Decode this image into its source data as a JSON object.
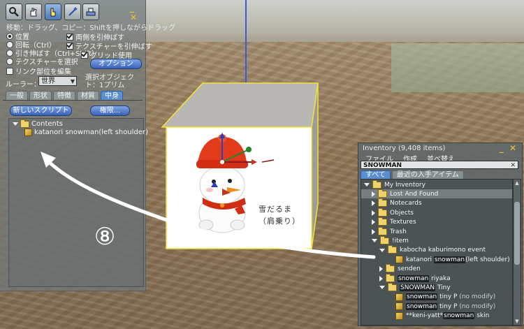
{
  "tool_panel": {
    "tools": [
      {
        "name": "zoom-tool-icon"
      },
      {
        "name": "grab-tool-icon"
      },
      {
        "name": "edit-tool-icon",
        "active": true
      },
      {
        "name": "create-tool-icon"
      },
      {
        "name": "land-tool-icon"
      }
    ],
    "window_controls": "_ ✕",
    "hint": "移動：ドラッグ、コピー：Shiftを押しながらドラッグ",
    "mode_options": [
      {
        "label": "位置",
        "selected": true
      },
      {
        "label": "回転（Ctrl）",
        "selected": false
      },
      {
        "label": "引き伸ばす（Ctrl+Shift）",
        "selected": false
      },
      {
        "label": "テクスチャーを選択",
        "selected": false
      }
    ],
    "checkbox_options": [
      {
        "label": "両側を引伸ばす",
        "checked": true
      },
      {
        "label": "テクスチャーを引伸ばす",
        "checked": true
      },
      {
        "label": "グリッド使用",
        "checked": true
      }
    ],
    "link_option": {
      "label": "リンク部位を編集",
      "checked": false
    },
    "options_button": "オプション",
    "ruler_label": "ルーラー：",
    "ruler_value": "世界",
    "ruler_note": "選択オブジェクト：1プリム",
    "tabs": [
      "一般",
      "形状",
      "特徴",
      "材質",
      "中身"
    ],
    "active_tab": "中身",
    "new_script_button": "新しいスクリプト",
    "permissions_button": "権限...",
    "contents": {
      "folder": "Contents",
      "items": [
        "katanori snowman(left shoulder)"
      ]
    }
  },
  "scene": {
    "label_line1": "雪だるま",
    "label_line2": "（肩乗り）"
  },
  "inventory": {
    "title": "Inventory (9,408 items)",
    "window_controls": "_ ✕",
    "menu": [
      "ファイル",
      "作成",
      "並べ替え"
    ],
    "search_value": "SNOWMAN",
    "search_clear": "✕",
    "tabs": [
      "すべて",
      "最近の入手アイテム"
    ],
    "rows": [
      {
        "depth": 0,
        "expander": "down",
        "icon": "folder",
        "label": "My Inventory"
      },
      {
        "depth": 1,
        "expander": "right",
        "icon": "folder-special",
        "label": "Lost And Found",
        "selected": true
      },
      {
        "depth": 1,
        "expander": "right",
        "icon": "folder-special",
        "label": "Notecards"
      },
      {
        "depth": 1,
        "expander": "right",
        "icon": "folder-special",
        "label": "Objects"
      },
      {
        "depth": 1,
        "expander": "right",
        "icon": "folder-special",
        "label": "Textures"
      },
      {
        "depth": 1,
        "expander": "right",
        "icon": "folder-special",
        "label": "Trash"
      },
      {
        "depth": 1,
        "expander": "down",
        "icon": "folder",
        "label": "!item"
      },
      {
        "depth": 2,
        "expander": "down",
        "icon": "folder",
        "label": "kabocha kaburimono event"
      },
      {
        "depth": 3,
        "expander": "none",
        "icon": "object",
        "pre": "katanori ",
        "hl": "snowman",
        "post": "(left shoulder)"
      },
      {
        "depth": 2,
        "expander": "right",
        "icon": "folder",
        "label": "senden"
      },
      {
        "depth": 2,
        "expander": "right",
        "icon": "folder",
        "pre": "",
        "hl": "snowman",
        "post": " riyaka"
      },
      {
        "depth": 2,
        "expander": "down",
        "icon": "folder",
        "pre": "",
        "hl": "SNOWMAN",
        "post": " Tiny"
      },
      {
        "depth": 3,
        "expander": "none",
        "icon": "object",
        "pre": "",
        "hl": "snowman",
        "post": " tiny P",
        "note": " (no modify)"
      },
      {
        "depth": 3,
        "expander": "none",
        "icon": "object",
        "pre": "",
        "hl": "snowman",
        "post": " tiny P",
        "note": " (no modify)"
      },
      {
        "depth": 3,
        "expander": "none",
        "icon": "object",
        "pre": "**keni-yatt*",
        "hl": "snowman",
        "post": " skin"
      }
    ]
  },
  "annotation": {
    "step_number": "⑧"
  }
}
